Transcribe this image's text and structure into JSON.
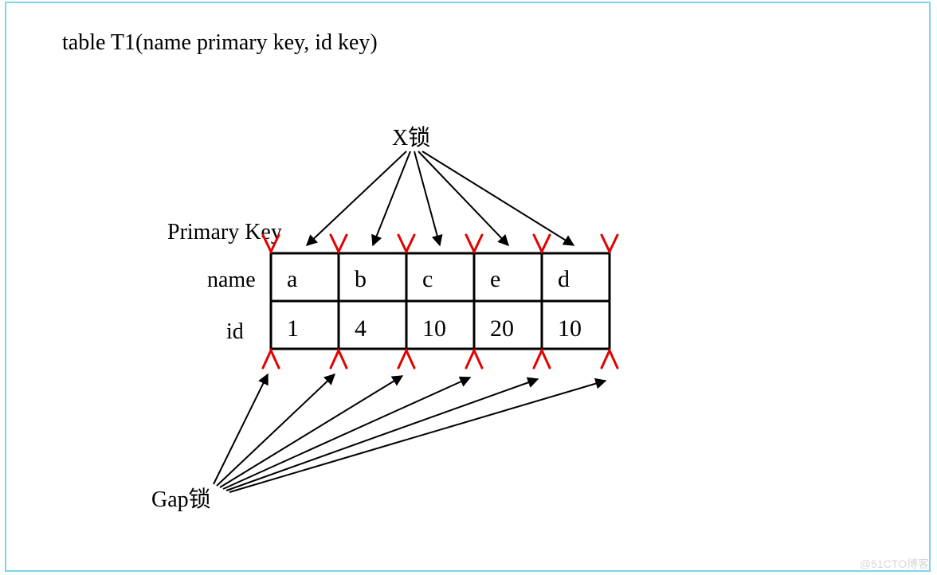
{
  "title": "table T1(name primary key, id key)",
  "labels": {
    "x_lock": "X锁",
    "primary_key": "Primary Key",
    "gap_lock": "Gap锁",
    "row_name": "name",
    "row_id": "id"
  },
  "table": {
    "name": [
      "a",
      "b",
      "c",
      "e",
      "d"
    ],
    "id": [
      "1",
      "4",
      "10",
      "20",
      "10"
    ]
  },
  "chart_data": {
    "type": "table",
    "title": "table T1(name primary key, id key)",
    "columns": [
      "name (Primary Key)",
      "id"
    ],
    "rows": [
      [
        "a",
        1
      ],
      [
        "b",
        4
      ],
      [
        "c",
        10
      ],
      [
        "e",
        20
      ],
      [
        "d",
        10
      ]
    ],
    "annotations": [
      "X锁 arrows point to each record (top)",
      "Gap锁 arrows point to each gap (bottom)"
    ]
  },
  "watermark": "@51CTO博客"
}
